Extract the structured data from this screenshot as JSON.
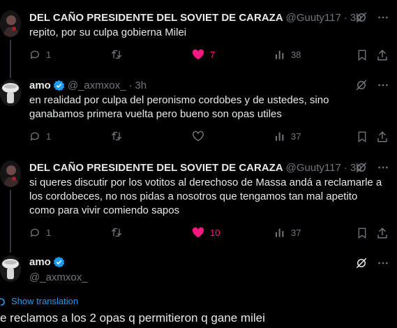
{
  "tweets": [
    {
      "name": "DEL CAÑO PRESIDENTE DEL SOVIET DE CARAZA",
      "handle": "@Guuty117",
      "time": "3h",
      "text": "repito, por su culpa gobierna Milei",
      "replies": "1",
      "retweets": "",
      "likes": "7",
      "liked": true,
      "views": "38"
    },
    {
      "name": "amo",
      "handle": "@_axmxox_",
      "time": "3h",
      "verified": true,
      "text": "en realidad por culpa del peronismo cordobes y de ustedes, sino ganabamos primera vuelta pero bueno son opas utiles",
      "replies": "1",
      "retweets": "",
      "likes": "",
      "liked": false,
      "views": "37"
    },
    {
      "name": "DEL CAÑO PRESIDENTE DEL SOVIET DE CARAZA",
      "handle": "@Guuty117",
      "time": "3h",
      "text": "si queres discutir por los votitos al derechoso de Massa andá a reclamarle a los cordobeces, no nos pidas a nosotros que tengamos tan mal apetito como para vivir comiendo sapos",
      "replies": "1",
      "retweets": "",
      "likes": "10",
      "liked": true,
      "views": "37"
    }
  ],
  "focus": {
    "name": "amo",
    "handle": "@_axmxox_",
    "show_translation": "Show translation",
    "text": "e reclamos a los 2 opas q permitieron q gane milei"
  },
  "colors": {
    "background": "#000000",
    "text": "#e7e9ea",
    "muted": "#71767b",
    "like": "#f91880",
    "accent": "#1d9bf0"
  },
  "icons": [
    "grok-icon",
    "more-icon",
    "reply-icon",
    "retweet-icon",
    "heart-icon",
    "views-icon",
    "bookmark-icon",
    "share-icon",
    "verified-icon",
    "translate-icon"
  ]
}
